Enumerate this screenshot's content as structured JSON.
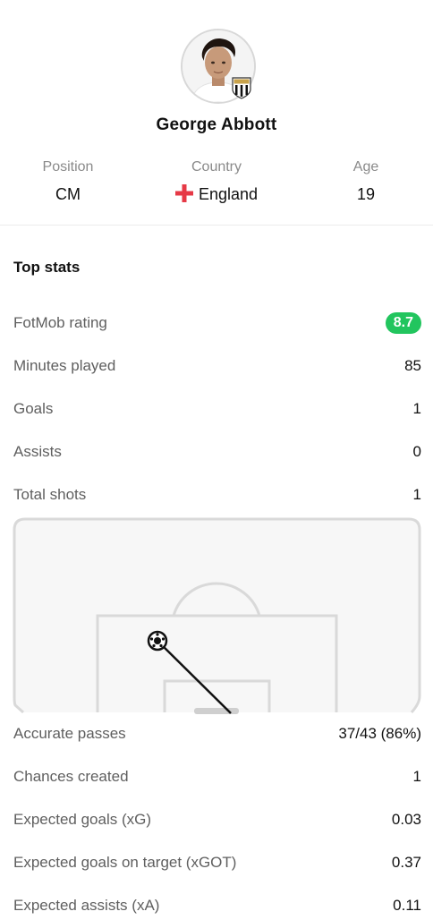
{
  "player": {
    "name": "George Abbott",
    "position_label": "Position",
    "position": "CM",
    "country_label": "Country",
    "country": "England",
    "age_label": "Age",
    "age": "19"
  },
  "top_stats": {
    "title": "Top stats",
    "rows": [
      {
        "label": "FotMob rating",
        "value": "8.7"
      },
      {
        "label": "Minutes played",
        "value": "85"
      },
      {
        "label": "Goals",
        "value": "1"
      },
      {
        "label": "Assists",
        "value": "0"
      },
      {
        "label": "Total shots",
        "value": "1"
      },
      {
        "label": "Accurate passes",
        "value": "37/43 (86%)"
      },
      {
        "label": "Chances created",
        "value": "1"
      },
      {
        "label": "Expected goals (xG)",
        "value": "0.03"
      },
      {
        "label": "Expected goals on target (xGOT)",
        "value": "0.37"
      },
      {
        "label": "Expected assists (xA)",
        "value": "0.11"
      }
    ]
  },
  "colors": {
    "rating_badge": "#22c55e",
    "flag_cross": "#e63946",
    "pitch_lines": "#d9d9d9"
  }
}
